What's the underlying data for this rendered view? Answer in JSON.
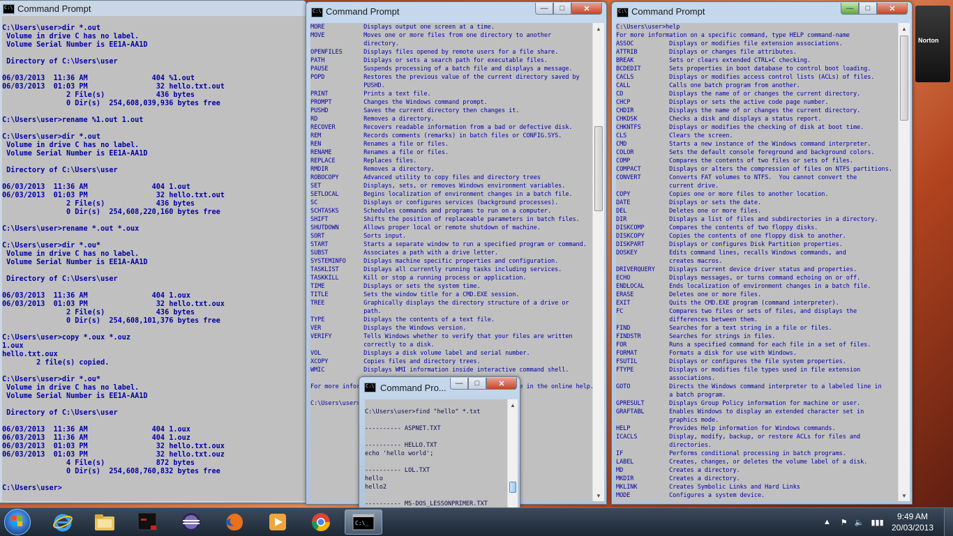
{
  "windows": {
    "left": {
      "title": "Command Prompt",
      "lines": [
        "C:\\Users\\user>dir *.out",
        " Volume in drive C has no label.",
        " Volume Serial Number is EE1A-AA1D",
        "",
        " Directory of C:\\Users\\user",
        "",
        "06/03/2013  11:36 AM               404 %1.out",
        "06/03/2013  01:03 PM                32 hello.txt.out",
        "               2 File(s)            436 bytes",
        "               0 Dir(s)  254,608,039,936 bytes free",
        "",
        "C:\\Users\\user>rename %1.out 1.out",
        "",
        "C:\\Users\\user>dir *.out",
        " Volume in drive C has no label.",
        " Volume Serial Number is EE1A-AA1D",
        "",
        " Directory of C:\\Users\\user",
        "",
        "06/03/2013  11:36 AM               404 1.out",
        "06/03/2013  01:03 PM                32 hello.txt.out",
        "               2 File(s)            436 bytes",
        "               0 Dir(s)  254,608,220,160 bytes free",
        "",
        "C:\\Users\\user>rename *.out *.oux",
        "",
        "C:\\Users\\user>dir *.ou*",
        " Volume in drive C has no label.",
        " Volume Serial Number is EE1A-AA1D",
        "",
        " Directory of C:\\Users\\user",
        "",
        "06/03/2013  11:36 AM               404 1.oux",
        "06/03/2013  01:03 PM                32 hello.txt.oux",
        "               2 File(s)            436 bytes",
        "               0 Dir(s)  254,608,101,376 bytes free",
        "",
        "C:\\Users\\user>copy *.oux *.ouz",
        "1.oux",
        "hello.txt.oux",
        "        2 file(s) copied.",
        "",
        "C:\\Users\\user>dir *.ou*",
        " Volume in drive C has no label.",
        " Volume Serial Number is EE1A-AA1D",
        "",
        " Directory of C:\\Users\\user",
        "",
        "06/03/2013  11:36 AM               404 1.oux",
        "06/03/2013  11:36 AM               404 1.ouz",
        "06/03/2013  01:03 PM                32 hello.txt.oux",
        "06/03/2013  01:03 PM                32 hello.txt.ouz",
        "               4 File(s)            872 bytes",
        "               0 Dir(s)  254,608,760,832 bytes free",
        "",
        "C:\\Users\\user>"
      ]
    },
    "middle": {
      "title": "Command Prompt",
      "lines": [
        "MORE           Displays output one screen at a time.",
        "MOVE           Moves one or more files from one directory to another",
        "               directory.",
        "OPENFILES      Displays files opened by remote users for a file share.",
        "PATH           Displays or sets a search path for executable files.",
        "PAUSE          Suspends processing of a batch file and displays a message.",
        "POPD           Restores the previous value of the current directory saved by",
        "               PUSHD.",
        "PRINT          Prints a text file.",
        "PROMPT         Changes the Windows command prompt.",
        "PUSHD          Saves the current directory then changes it.",
        "RD             Removes a directory.",
        "RECOVER        Recovers readable information from a bad or defective disk.",
        "REM            Records comments (remarks) in batch files or CONFIG.SYS.",
        "REN            Renames a file or files.",
        "RENAME         Renames a file or files.",
        "REPLACE        Replaces files.",
        "RMDIR          Removes a directory.",
        "ROBOCOPY       Advanced utility to copy files and directory trees",
        "SET            Displays, sets, or removes Windows environment variables.",
        "SETLOCAL       Begins localization of environment changes in a batch file.",
        "SC             Displays or configures services (background processes).",
        "SCHTASKS       Schedules commands and programs to run on a computer.",
        "SHIFT          Shifts the position of replaceable parameters in batch files.",
        "SHUTDOWN       Allows proper local or remote shutdown of machine.",
        "SORT           Sorts input.",
        "START          Starts a separate window to run a specified program or command.",
        "SUBST          Associates a path with a drive letter.",
        "SYSTEMINFO     Displays machine specific properties and configuration.",
        "TASKLIST       Displays all currently running tasks including services.",
        "TASKKILL       Kill or stop a running process or application.",
        "TIME           Displays or sets the system time.",
        "TITLE          Sets the window title for a CMD.EXE session.",
        "TREE           Graphically displays the directory structure of a drive or",
        "               path.",
        "TYPE           Displays the contents of a text file.",
        "VER            Displays the Windows version.",
        "VERIFY         Tells Windows whether to verify that your files are written",
        "               correctly to a disk.",
        "VOL            Displays a disk volume label and serial number.",
        "XCOPY          Copies files and directory trees.",
        "WMIC           Displays WMI information inside interactive command shell.",
        "",
        "For more information on tools see the command-line reference in the online help.",
        "",
        "C:\\Users\\user>"
      ]
    },
    "right": {
      "title": "Command Prompt",
      "lines": [
        "C:\\Users\\user>help",
        "For more information on a specific command, type HELP command-name",
        "ASSOC          Displays or modifies file extension associations.",
        "ATTRIB         Displays or changes file attributes.",
        "BREAK          Sets or clears extended CTRL+C checking.",
        "BCDEDIT        Sets properties in boot database to control boot loading.",
        "CACLS          Displays or modifies access control lists (ACLs) of files.",
        "CALL           Calls one batch program from another.",
        "CD             Displays the name of or changes the current directory.",
        "CHCP           Displays or sets the active code page number.",
        "CHDIR          Displays the name of or changes the current directory.",
        "CHKDSK         Checks a disk and displays a status report.",
        "CHKNTFS        Displays or modifies the checking of disk at boot time.",
        "CLS            Clears the screen.",
        "CMD            Starts a new instance of the Windows command interpreter.",
        "COLOR          Sets the default console foreground and background colors.",
        "COMP           Compares the contents of two files or sets of files.",
        "COMPACT        Displays or alters the compression of files on NTFS partitions.",
        "CONVERT        Converts FAT volumes to NTFS.  You cannot convert the",
        "               current drive.",
        "COPY           Copies one or more files to another location.",
        "DATE           Displays or sets the date.",
        "DEL            Deletes one or more files.",
        "DIR            Displays a list of files and subdirectories in a directory.",
        "DISKCOMP       Compares the contents of two floppy disks.",
        "DISKCOPY       Copies the contents of one floppy disk to another.",
        "DISKPART       Displays or configures Disk Partition properties.",
        "DOSKEY         Edits command lines, recalls Windows commands, and",
        "               creates macros.",
        "DRIVERQUERY    Displays current device driver status and properties.",
        "ECHO           Displays messages, or turns command echoing on or off.",
        "ENDLOCAL       Ends localization of environment changes in a batch file.",
        "ERASE          Deletes one or more files.",
        "EXIT           Quits the CMD.EXE program (command interpreter).",
        "FC             Compares two files or sets of files, and displays the",
        "               differences between them.",
        "FIND           Searches for a text string in a file or files.",
        "FINDSTR        Searches for strings in files.",
        "FOR            Runs a specified command for each file in a set of files.",
        "FORMAT         Formats a disk for use with Windows.",
        "FSUTIL         Displays or configures the file system properties.",
        "FTYPE          Displays or modifies file types used in file extension",
        "               associations.",
        "GOTO           Directs the Windows command interpreter to a labeled line in",
        "               a batch program.",
        "GPRESULT       Displays Group Policy information for machine or user.",
        "GRAFTABL       Enables Windows to display an extended character set in",
        "               graphics mode.",
        "HELP           Provides Help information for Windows commands.",
        "ICACLS         Display, modify, backup, or restore ACLs for files and",
        "               directories.",
        "IF             Performs conditional processing in batch programs.",
        "LABEL          Creates, changes, or deletes the volume label of a disk.",
        "MD             Creates a directory.",
        "MKDIR          Creates a directory.",
        "MKLINK         Creates Symbolic Links and Hard Links",
        "MODE           Configures a system device."
      ]
    },
    "small": {
      "title": "Command Pro...",
      "lines": [
        "",
        "C:\\Users\\user>find \"hello\" *.txt",
        "",
        "---------- ASPNET.TXT",
        "",
        "---------- HELLO.TXT",
        "echo 'hello world';",
        "",
        "---------- LOL.TXT",
        "hello",
        "hello2",
        "",
        "---------- MS-DOS_LESSONPRIMER.TXT"
      ]
    }
  },
  "taskbar": {
    "icons": [
      "start-orb",
      "internet-explorer-icon",
      "windows-explorer-icon",
      "black-app-icon",
      "eclipse-icon",
      "firefox-icon",
      "media-player-icon",
      "chrome-icon",
      "command-prompt-icon"
    ],
    "clock_time": "9:49 AM",
    "clock_date": "20/03/2013"
  },
  "norton": {
    "label": "Norton"
  },
  "colors": {
    "console_bg": "#c0c0c0",
    "console_text": "#0000a8",
    "taskbar": "#1d2835"
  }
}
